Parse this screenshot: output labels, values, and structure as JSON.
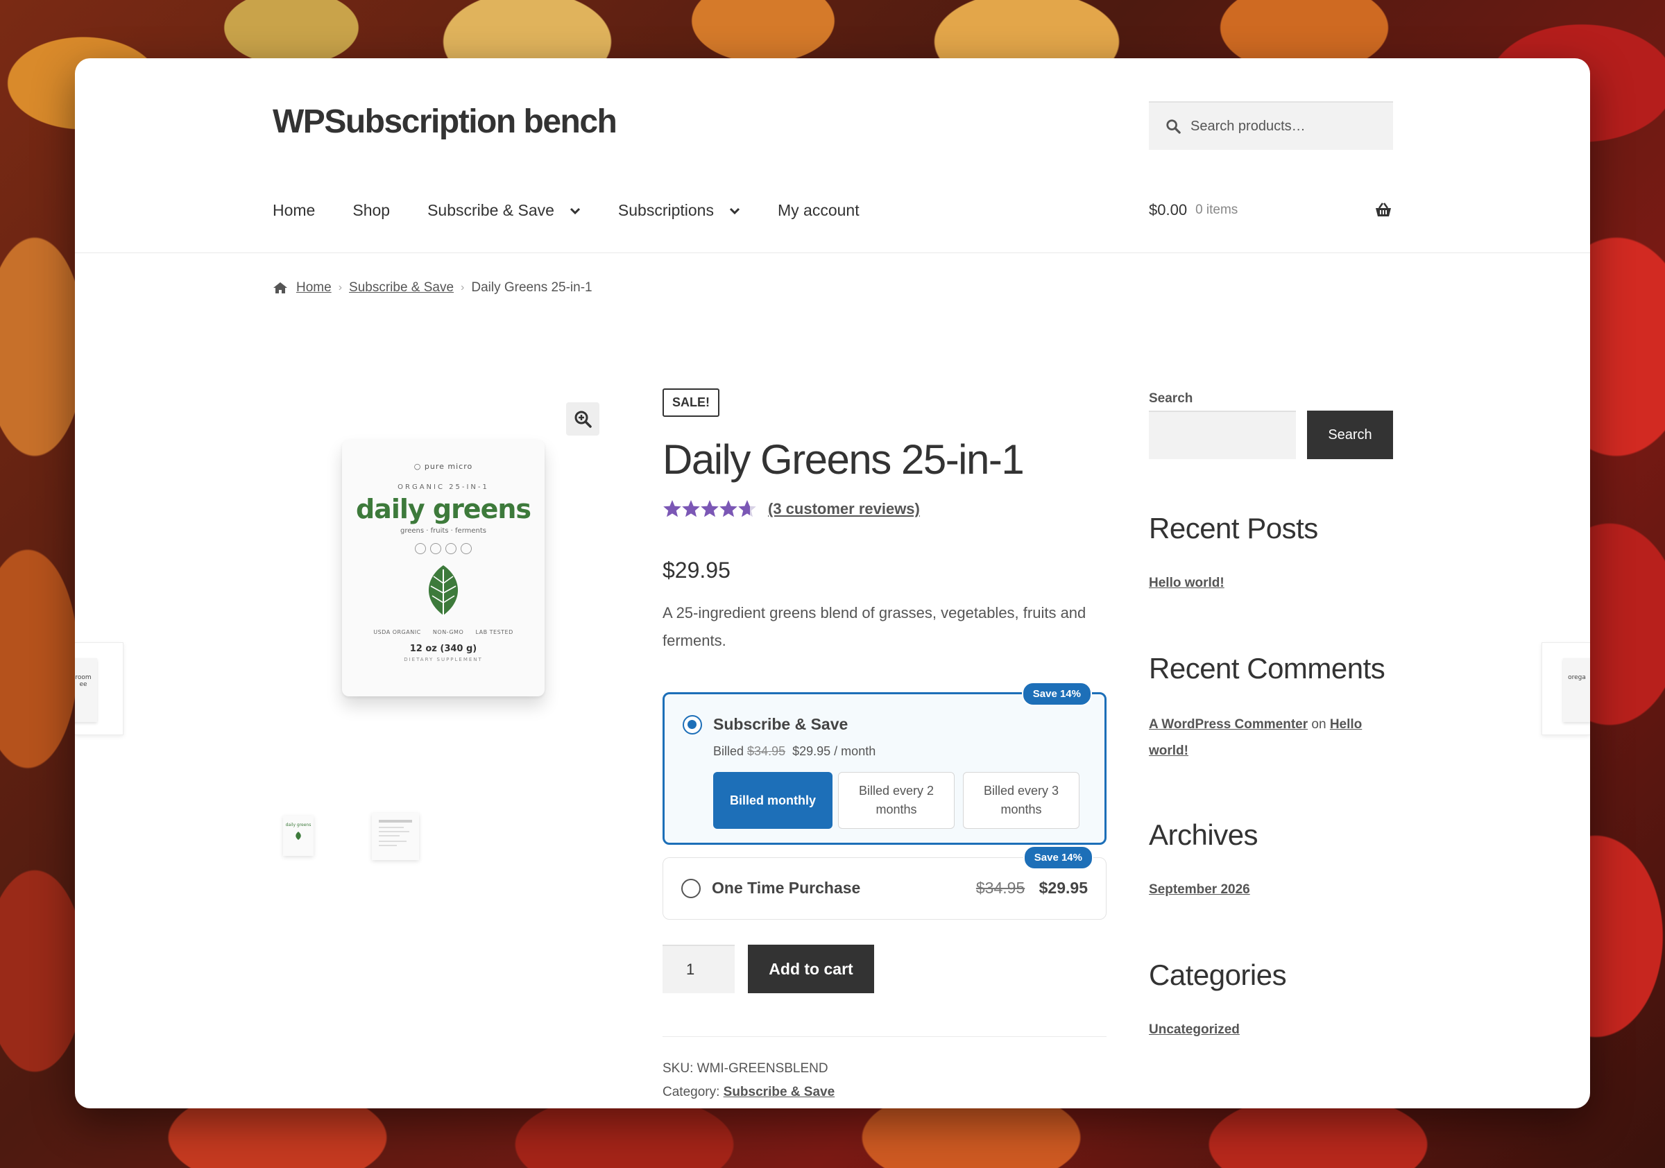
{
  "site": {
    "title": "WPSubscription bench"
  },
  "header_search": {
    "placeholder": "Search products…"
  },
  "nav": {
    "items": [
      "Home",
      "Shop",
      "Subscribe & Save",
      "Subscriptions",
      "My account"
    ]
  },
  "cart": {
    "amount": "$0.00",
    "count": "0 items"
  },
  "breadcrumb": {
    "home": "Home",
    "category": "Subscribe & Save",
    "current": "Daily Greens 25-in-1"
  },
  "gallery": {
    "pouch": {
      "brand": "pure micro",
      "subtitle": "ORGANIC 25-IN-1",
      "name": "daily greens",
      "tagline": "greens · fruits · ferments",
      "badges": [
        "USDA ORGANIC",
        "NON-GMO",
        "LAB TESTED"
      ],
      "weight": "12 oz (340 g)",
      "dietary": "DIETARY SUPPLEMENT"
    },
    "side_left_text": "room\nee",
    "side_right_text": "orega"
  },
  "product": {
    "sale_badge": "SALE!",
    "title": "Daily Greens 25-in-1",
    "rating": 4.67,
    "reviews_link": "(3 customer reviews)",
    "price": "$29.95",
    "description": "A 25-ingredient greens blend of grasses, vegetables, fruits and ferments."
  },
  "purchase_options": {
    "subscribe": {
      "label": "Subscribe & Save",
      "save_badge": "Save 14%",
      "billed_prefix": "Billed",
      "regular_price": "$34.95",
      "sale_price": "$29.95 / month",
      "frequencies": [
        "Billed monthly",
        "Billed every 2 months",
        "Billed every 3 months"
      ],
      "selected_frequency": "Billed monthly",
      "selected": true
    },
    "one_time": {
      "label": "One Time Purchase",
      "save_badge": "Save 14%",
      "regular_price": "$34.95",
      "sale_price": "$29.95",
      "selected": false
    }
  },
  "add_to_cart": {
    "quantity": "1",
    "button": "Add to cart"
  },
  "meta": {
    "sku_label": "SKU:",
    "sku": "WMI-GREENSBLEND",
    "category_label": "Category:",
    "category": "Subscribe & Save"
  },
  "sidebar": {
    "search_label": "Search",
    "search_button": "Search",
    "recent_posts_title": "Recent Posts",
    "recent_posts": [
      "Hello world!"
    ],
    "recent_comments_title": "Recent Comments",
    "comment_author": "A WordPress Commenter",
    "comment_on": "on",
    "comment_post": "Hello world!",
    "archives_title": "Archives",
    "archives": [
      "September 2026"
    ],
    "categories_title": "Categories",
    "categories": [
      "Uncategorized"
    ]
  },
  "colors": {
    "accent": "#1d6fb8",
    "star": "#7b57b5",
    "dark_button": "#333333"
  }
}
